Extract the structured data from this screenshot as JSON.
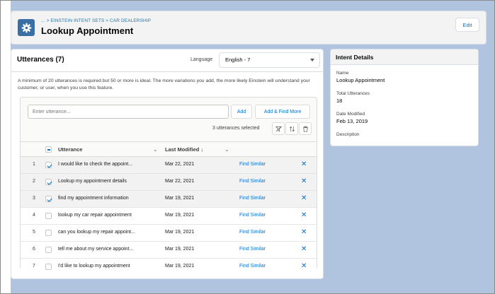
{
  "header": {
    "icon": "gear-icon",
    "breadcrumb": "... > EINSTEIN INTENT SETS > CAR DEALERSHIP",
    "title": "Lookup Appointment",
    "edit_label": "Edit"
  },
  "utterances": {
    "title": "Utterances (7)",
    "language_label": "Language",
    "language_value": "English - 7",
    "description": "A minimum of 20 utterances is required but 50 or more is ideal. The more variations you add, the more likely Einstein will understand your customer, or user, when you use this feature.",
    "input_placeholder": "Enter utterance...",
    "add_label": "Add",
    "add_find_label": "Add & Find More",
    "selected_text": "3 utterances selected",
    "columns": {
      "utterance": "Utterance",
      "last_modified": "Last Modified ↓"
    },
    "rows": [
      {
        "num": "1",
        "checked": true,
        "text": "I would like to check the appoint...",
        "date": "Mar 22, 2021",
        "action": "Find Similar"
      },
      {
        "num": "2",
        "checked": true,
        "text": "Lookup my appointment details",
        "date": "Mar 22, 2021",
        "action": "Find Similar"
      },
      {
        "num": "3",
        "checked": true,
        "text": "find my appointment information",
        "date": "Mar 19, 2021",
        "action": "Find Similar"
      },
      {
        "num": "4",
        "checked": false,
        "text": "lookup my car repair appointment",
        "date": "Mar 19, 2021",
        "action": "Find Similar"
      },
      {
        "num": "5",
        "checked": false,
        "text": "can you lookup my repair appoint...",
        "date": "Mar 19, 2021",
        "action": "Find Similar"
      },
      {
        "num": "6",
        "checked": false,
        "text": "tell me about my service appoint...",
        "date": "Mar 19, 2021",
        "action": "Find Similar"
      },
      {
        "num": "7",
        "checked": false,
        "text": "I'd like to lookup my appointment",
        "date": "Mar 19, 2021",
        "action": "Find Similar"
      }
    ]
  },
  "details": {
    "title": "Intent Details",
    "name_label": "Name",
    "name_value": "Lookup Appointment",
    "total_label": "Total Utterances",
    "total_value": "18",
    "modified_label": "Date Modified",
    "modified_value": "Feb 13, 2019",
    "description_label": "Description"
  },
  "colors": {
    "brand_link": "#0070d2",
    "page_bg": "#b0c4df",
    "icon_bg": "#3a6fa6"
  }
}
